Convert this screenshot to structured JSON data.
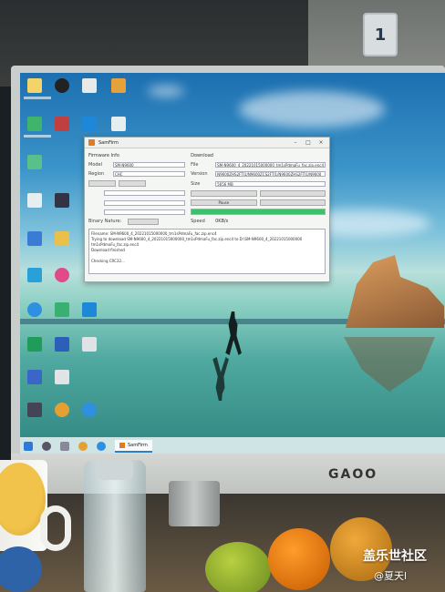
{
  "wall": {
    "sticker_number": "1"
  },
  "monitor": {
    "brand": "GAOO"
  },
  "window": {
    "title": "SamFirm",
    "left_section": "Firmware Info",
    "model_label": "Model",
    "model_value": "SM-N9600",
    "region_label": "Region",
    "region_value": "CHC",
    "binary_nature_label": "Binary Nature:",
    "right_section": "Download",
    "file_label": "File",
    "file_value": "SM-N9600_4_20221015000000_tm1sPdmaFu_fac.zip.enc4",
    "version_label": "Version",
    "version_value": "N9600ZHS2FTJ1/N9600ZCS2FTJ1/N9600ZHS2FTJ1/N9600",
    "size_label": "Size",
    "size_value": "5656 MB",
    "pause_label": "Pause",
    "progress_percent": 100,
    "speed_label": "Speed",
    "speed_value": "0KB/s",
    "log_lines": [
      "Filename: SM-N9600_4_20221015000000_tm1sPdmaFu_fac.zip.enc4",
      "Trying to download SM-N9600_4_20221015000000_tm1sPdmaFu_fac.zip.enc4 to D:\\SM-N9600_4_20221015000000",
      "tm1sPdmaFu_fac.zip.enc4",
      "Download finished",
      "",
      "Checking CRC32..."
    ]
  },
  "taskbar": {
    "app_label": "SamFirm"
  },
  "watermark": {
    "site": "盖乐世社区",
    "user": "@夏天l"
  }
}
